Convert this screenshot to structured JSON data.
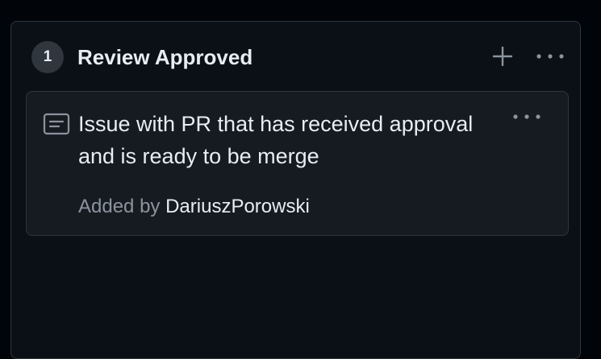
{
  "column": {
    "count": "1",
    "title": "Review Approved",
    "add_icon": "plus-icon",
    "more_icon": "kebab-horizontal-icon"
  },
  "card": {
    "icon": "draft-issue-icon",
    "title": "Issue with PR that has received approval and is ready to be merge",
    "more_icon": "kebab-horizontal-icon",
    "added_by_prefix": "Added by",
    "author": "DariuszPorowski"
  },
  "colors": {
    "background": "#010409",
    "column_bg": "#0b0f16",
    "card_bg": "#161b22",
    "border": "#30363d",
    "text_primary": "#e6edf3",
    "text_muted": "#8b949e"
  }
}
